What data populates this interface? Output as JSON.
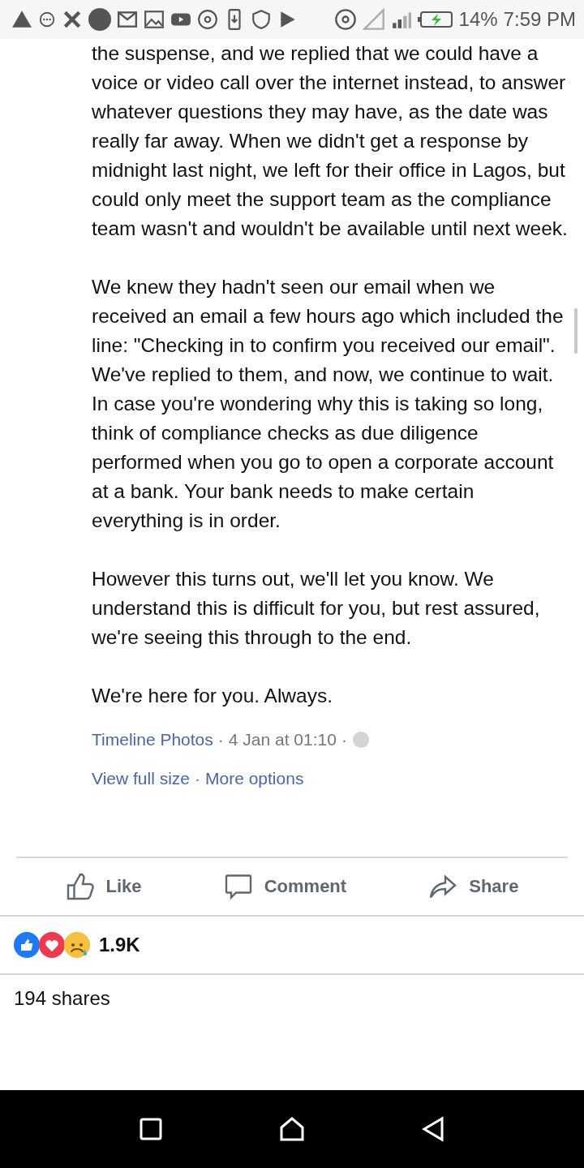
{
  "status_bar": {
    "battery": "14%",
    "time": "7:59 PM"
  },
  "post": {
    "paragraphs": [
      "the suspense, and we replied that we could have a voice or video call over the internet instead, to answer whatever questions they may have, as the date was really far away. When we didn't get a response by midnight last night, we left for their office in Lagos, but could only meet the support team as the compliance team wasn't and wouldn't be available until next week.",
      "We knew they hadn't seen our email when we received an email a few hours ago which included the line: \"Checking in to confirm you received our email\". We've replied to them, and now, we continue to wait. In case you're wondering why this is taking so long, think of compliance checks as due diligence performed when you go to open a corporate account at a bank. Your bank needs to make certain everything is in order.",
      "However this turns out, we'll let you know. We understand this is difficult for you, but rest assured, we're seeing this through to the end.",
      "We're here for you. Always."
    ],
    "album": "Timeline Photos",
    "separator": "·",
    "date": "4 Jan at 01:10",
    "links": [
      "View full size",
      "More options"
    ]
  },
  "actions": [
    "Like",
    "Comment",
    "Share"
  ],
  "reactions": {
    "count": "1.9K"
  },
  "shares": "194 shares"
}
